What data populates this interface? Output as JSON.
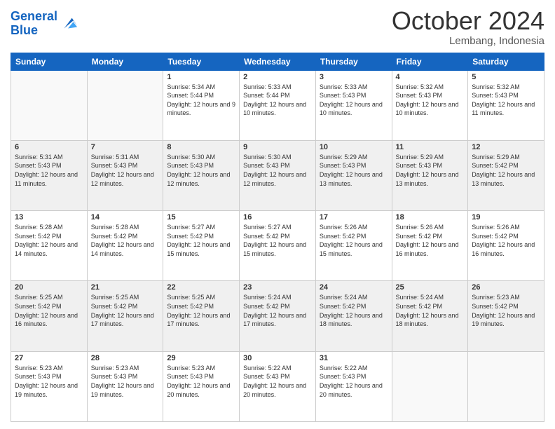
{
  "logo": {
    "line1": "General",
    "line2": "Blue"
  },
  "header": {
    "month": "October 2024",
    "location": "Lembang, Indonesia"
  },
  "weekdays": [
    "Sunday",
    "Monday",
    "Tuesday",
    "Wednesday",
    "Thursday",
    "Friday",
    "Saturday"
  ],
  "weeks": [
    [
      {
        "day": "",
        "empty": true
      },
      {
        "day": "",
        "empty": true
      },
      {
        "day": "1",
        "sunrise": "5:34 AM",
        "sunset": "5:44 PM",
        "daylight": "12 hours and 9 minutes."
      },
      {
        "day": "2",
        "sunrise": "5:33 AM",
        "sunset": "5:44 PM",
        "daylight": "12 hours and 10 minutes."
      },
      {
        "day": "3",
        "sunrise": "5:33 AM",
        "sunset": "5:43 PM",
        "daylight": "12 hours and 10 minutes."
      },
      {
        "day": "4",
        "sunrise": "5:32 AM",
        "sunset": "5:43 PM",
        "daylight": "12 hours and 10 minutes."
      },
      {
        "day": "5",
        "sunrise": "5:32 AM",
        "sunset": "5:43 PM",
        "daylight": "12 hours and 11 minutes."
      }
    ],
    [
      {
        "day": "6",
        "sunrise": "5:31 AM",
        "sunset": "5:43 PM",
        "daylight": "12 hours and 11 minutes."
      },
      {
        "day": "7",
        "sunrise": "5:31 AM",
        "sunset": "5:43 PM",
        "daylight": "12 hours and 12 minutes."
      },
      {
        "day": "8",
        "sunrise": "5:30 AM",
        "sunset": "5:43 PM",
        "daylight": "12 hours and 12 minutes."
      },
      {
        "day": "9",
        "sunrise": "5:30 AM",
        "sunset": "5:43 PM",
        "daylight": "12 hours and 12 minutes."
      },
      {
        "day": "10",
        "sunrise": "5:29 AM",
        "sunset": "5:43 PM",
        "daylight": "12 hours and 13 minutes."
      },
      {
        "day": "11",
        "sunrise": "5:29 AM",
        "sunset": "5:43 PM",
        "daylight": "12 hours and 13 minutes."
      },
      {
        "day": "12",
        "sunrise": "5:29 AM",
        "sunset": "5:42 PM",
        "daylight": "12 hours and 13 minutes."
      }
    ],
    [
      {
        "day": "13",
        "sunrise": "5:28 AM",
        "sunset": "5:42 PM",
        "daylight": "12 hours and 14 minutes."
      },
      {
        "day": "14",
        "sunrise": "5:28 AM",
        "sunset": "5:42 PM",
        "daylight": "12 hours and 14 minutes."
      },
      {
        "day": "15",
        "sunrise": "5:27 AM",
        "sunset": "5:42 PM",
        "daylight": "12 hours and 15 minutes."
      },
      {
        "day": "16",
        "sunrise": "5:27 AM",
        "sunset": "5:42 PM",
        "daylight": "12 hours and 15 minutes."
      },
      {
        "day": "17",
        "sunrise": "5:26 AM",
        "sunset": "5:42 PM",
        "daylight": "12 hours and 15 minutes."
      },
      {
        "day": "18",
        "sunrise": "5:26 AM",
        "sunset": "5:42 PM",
        "daylight": "12 hours and 16 minutes."
      },
      {
        "day": "19",
        "sunrise": "5:26 AM",
        "sunset": "5:42 PM",
        "daylight": "12 hours and 16 minutes."
      }
    ],
    [
      {
        "day": "20",
        "sunrise": "5:25 AM",
        "sunset": "5:42 PM",
        "daylight": "12 hours and 16 minutes."
      },
      {
        "day": "21",
        "sunrise": "5:25 AM",
        "sunset": "5:42 PM",
        "daylight": "12 hours and 17 minutes."
      },
      {
        "day": "22",
        "sunrise": "5:25 AM",
        "sunset": "5:42 PM",
        "daylight": "12 hours and 17 minutes."
      },
      {
        "day": "23",
        "sunrise": "5:24 AM",
        "sunset": "5:42 PM",
        "daylight": "12 hours and 17 minutes."
      },
      {
        "day": "24",
        "sunrise": "5:24 AM",
        "sunset": "5:42 PM",
        "daylight": "12 hours and 18 minutes."
      },
      {
        "day": "25",
        "sunrise": "5:24 AM",
        "sunset": "5:42 PM",
        "daylight": "12 hours and 18 minutes."
      },
      {
        "day": "26",
        "sunrise": "5:23 AM",
        "sunset": "5:42 PM",
        "daylight": "12 hours and 19 minutes."
      }
    ],
    [
      {
        "day": "27",
        "sunrise": "5:23 AM",
        "sunset": "5:43 PM",
        "daylight": "12 hours and 19 minutes."
      },
      {
        "day": "28",
        "sunrise": "5:23 AM",
        "sunset": "5:43 PM",
        "daylight": "12 hours and 19 minutes."
      },
      {
        "day": "29",
        "sunrise": "5:23 AM",
        "sunset": "5:43 PM",
        "daylight": "12 hours and 20 minutes."
      },
      {
        "day": "30",
        "sunrise": "5:22 AM",
        "sunset": "5:43 PM",
        "daylight": "12 hours and 20 minutes."
      },
      {
        "day": "31",
        "sunrise": "5:22 AM",
        "sunset": "5:43 PM",
        "daylight": "12 hours and 20 minutes."
      },
      {
        "day": "",
        "empty": true
      },
      {
        "day": "",
        "empty": true
      }
    ]
  ]
}
